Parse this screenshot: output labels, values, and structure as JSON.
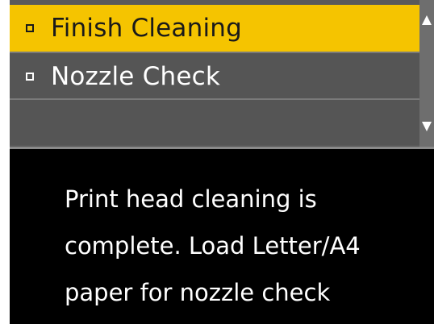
{
  "menu": {
    "items": [
      {
        "label": "Finish Cleaning",
        "selected": true
      },
      {
        "label": "Nozzle Check",
        "selected": false
      }
    ]
  },
  "message": {
    "lines": [
      "Print head cleaning is",
      "complete. Load Letter/A4",
      "paper for nozzle check"
    ]
  },
  "colors": {
    "highlight": "#f5c400",
    "menu_background": "#555555",
    "screen_background": "#000000",
    "text_light": "#ffffff"
  },
  "icons": {
    "scroll_up": "triangle-up-icon",
    "scroll_down": "triangle-down-icon",
    "bullet": "square-bullet-icon"
  }
}
